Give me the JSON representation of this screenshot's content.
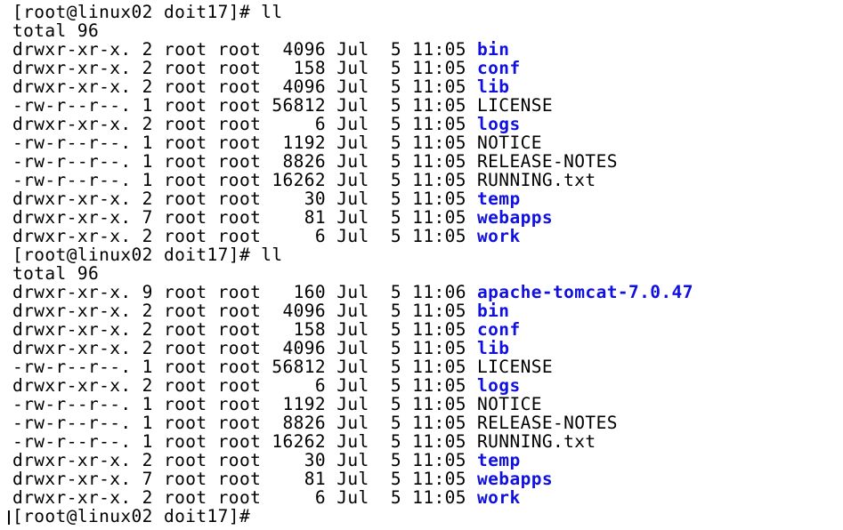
{
  "terminal": {
    "blocks": [
      {
        "prompt": "[root@linux02 doit17]# ll",
        "total": "total 96",
        "entries": [
          {
            "perms": "drwxr-xr-x.",
            "links": "2",
            "owner": "root",
            "group": "root",
            "size": "4096",
            "month": "Jul",
            "day": "5",
            "time": "11:05",
            "name": "bin",
            "type": "dir"
          },
          {
            "perms": "drwxr-xr-x.",
            "links": "2",
            "owner": "root",
            "group": "root",
            "size": "158",
            "month": "Jul",
            "day": "5",
            "time": "11:05",
            "name": "conf",
            "type": "dir"
          },
          {
            "perms": "drwxr-xr-x.",
            "links": "2",
            "owner": "root",
            "group": "root",
            "size": "4096",
            "month": "Jul",
            "day": "5",
            "time": "11:05",
            "name": "lib",
            "type": "dir"
          },
          {
            "perms": "-rw-r--r--.",
            "links": "1",
            "owner": "root",
            "group": "root",
            "size": "56812",
            "month": "Jul",
            "day": "5",
            "time": "11:05",
            "name": "LICENSE",
            "type": "file"
          },
          {
            "perms": "drwxr-xr-x.",
            "links": "2",
            "owner": "root",
            "group": "root",
            "size": "6",
            "month": "Jul",
            "day": "5",
            "time": "11:05",
            "name": "logs",
            "type": "dir"
          },
          {
            "perms": "-rw-r--r--.",
            "links": "1",
            "owner": "root",
            "group": "root",
            "size": "1192",
            "month": "Jul",
            "day": "5",
            "time": "11:05",
            "name": "NOTICE",
            "type": "file"
          },
          {
            "perms": "-rw-r--r--.",
            "links": "1",
            "owner": "root",
            "group": "root",
            "size": "8826",
            "month": "Jul",
            "day": "5",
            "time": "11:05",
            "name": "RELEASE-NOTES",
            "type": "file"
          },
          {
            "perms": "-rw-r--r--.",
            "links": "1",
            "owner": "root",
            "group": "root",
            "size": "16262",
            "month": "Jul",
            "day": "5",
            "time": "11:05",
            "name": "RUNNING.txt",
            "type": "file"
          },
          {
            "perms": "drwxr-xr-x.",
            "links": "2",
            "owner": "root",
            "group": "root",
            "size": "30",
            "month": "Jul",
            "day": "5",
            "time": "11:05",
            "name": "temp",
            "type": "dir"
          },
          {
            "perms": "drwxr-xr-x.",
            "links": "7",
            "owner": "root",
            "group": "root",
            "size": "81",
            "month": "Jul",
            "day": "5",
            "time": "11:05",
            "name": "webapps",
            "type": "dir"
          },
          {
            "perms": "drwxr-xr-x.",
            "links": "2",
            "owner": "root",
            "group": "root",
            "size": "6",
            "month": "Jul",
            "day": "5",
            "time": "11:05",
            "name": "work",
            "type": "dir"
          }
        ]
      },
      {
        "prompt": "[root@linux02 doit17]# ll",
        "total": "total 96",
        "entries": [
          {
            "perms": "drwxr-xr-x.",
            "links": "9",
            "owner": "root",
            "group": "root",
            "size": "160",
            "month": "Jul",
            "day": "5",
            "time": "11:06",
            "name": "apache-tomcat-7.0.47",
            "type": "dir"
          },
          {
            "perms": "drwxr-xr-x.",
            "links": "2",
            "owner": "root",
            "group": "root",
            "size": "4096",
            "month": "Jul",
            "day": "5",
            "time": "11:05",
            "name": "bin",
            "type": "dir"
          },
          {
            "perms": "drwxr-xr-x.",
            "links": "2",
            "owner": "root",
            "group": "root",
            "size": "158",
            "month": "Jul",
            "day": "5",
            "time": "11:05",
            "name": "conf",
            "type": "dir"
          },
          {
            "perms": "drwxr-xr-x.",
            "links": "2",
            "owner": "root",
            "group": "root",
            "size": "4096",
            "month": "Jul",
            "day": "5",
            "time": "11:05",
            "name": "lib",
            "type": "dir"
          },
          {
            "perms": "-rw-r--r--.",
            "links": "1",
            "owner": "root",
            "group": "root",
            "size": "56812",
            "month": "Jul",
            "day": "5",
            "time": "11:05",
            "name": "LICENSE",
            "type": "file"
          },
          {
            "perms": "drwxr-xr-x.",
            "links": "2",
            "owner": "root",
            "group": "root",
            "size": "6",
            "month": "Jul",
            "day": "5",
            "time": "11:05",
            "name": "logs",
            "type": "dir"
          },
          {
            "perms": "-rw-r--r--.",
            "links": "1",
            "owner": "root",
            "group": "root",
            "size": "1192",
            "month": "Jul",
            "day": "5",
            "time": "11:05",
            "name": "NOTICE",
            "type": "file"
          },
          {
            "perms": "-rw-r--r--.",
            "links": "1",
            "owner": "root",
            "group": "root",
            "size": "8826",
            "month": "Jul",
            "day": "5",
            "time": "11:05",
            "name": "RELEASE-NOTES",
            "type": "file"
          },
          {
            "perms": "-rw-r--r--.",
            "links": "1",
            "owner": "root",
            "group": "root",
            "size": "16262",
            "month": "Jul",
            "day": "5",
            "time": "11:05",
            "name": "RUNNING.txt",
            "type": "file"
          },
          {
            "perms": "drwxr-xr-x.",
            "links": "2",
            "owner": "root",
            "group": "root",
            "size": "30",
            "month": "Jul",
            "day": "5",
            "time": "11:05",
            "name": "temp",
            "type": "dir"
          },
          {
            "perms": "drwxr-xr-x.",
            "links": "7",
            "owner": "root",
            "group": "root",
            "size": "81",
            "month": "Jul",
            "day": "5",
            "time": "11:05",
            "name": "webapps",
            "type": "dir"
          },
          {
            "perms": "drwxr-xr-x.",
            "links": "2",
            "owner": "root",
            "group": "root",
            "size": "6",
            "month": "Jul",
            "day": "5",
            "time": "11:05",
            "name": "work",
            "type": "dir"
          }
        ]
      }
    ],
    "final_prompt": "[root@linux02 doit17]#"
  },
  "colors": {
    "background": "#ffffff",
    "text": "#000000",
    "directory": "#1010e0"
  }
}
